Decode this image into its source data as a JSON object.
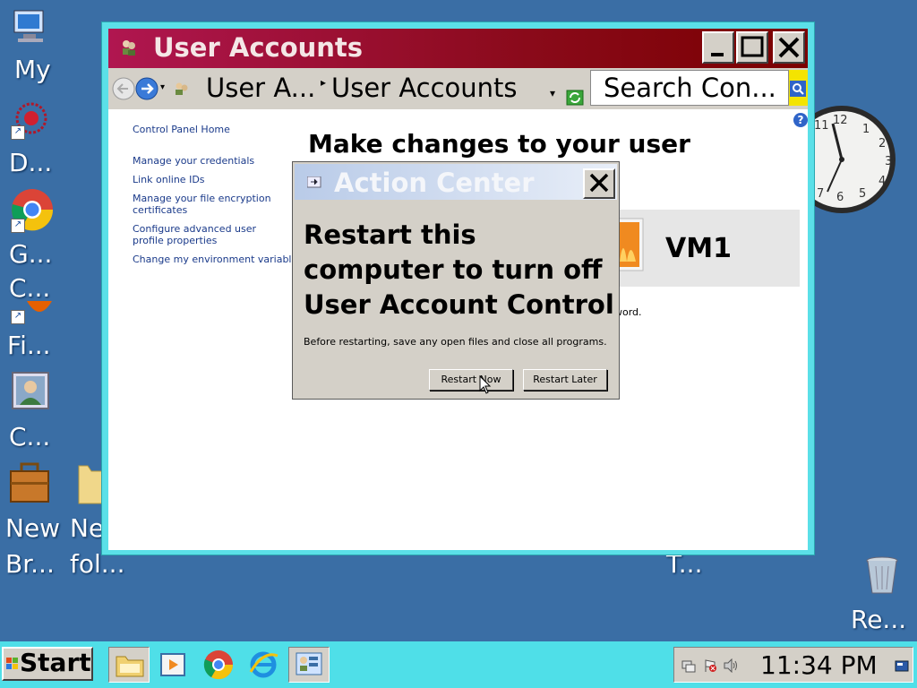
{
  "desktop": {
    "icons": [
      {
        "name": "my-computer",
        "label": "My"
      },
      {
        "name": "d-shortcut",
        "label": "D..."
      },
      {
        "name": "google-chrome",
        "label_line1": "G...",
        "label_line2": "C..."
      },
      {
        "name": "firefox",
        "label": "Fi..."
      },
      {
        "name": "c-shortcut",
        "label": "C..."
      },
      {
        "name": "new-briefcase",
        "label_line1": "New",
        "label_line2": "Br..."
      },
      {
        "name": "new-folder",
        "label_line1": "Ne",
        "label_line2": "fol..."
      },
      {
        "name": "recycle-bin",
        "label": "Re..."
      }
    ],
    "hidden_label_fragment": "T..."
  },
  "window": {
    "title": "User Accounts",
    "breadcrumb_1": "User A...",
    "breadcrumb_2": "User Accounts",
    "search_placeholder": "Search Con...",
    "sidebar": {
      "home": "Control Panel Home",
      "links": [
        "Manage your credentials",
        "Link online IDs",
        "Manage your file encryption certificates",
        "Configure advanced user profile properties",
        "Change my environment variables"
      ]
    },
    "heading": "Make changes to your user",
    "account_name": "VM1",
    "partial_text": "word."
  },
  "dialog": {
    "title": "Action Center",
    "message": "Restart this computer to turn off User Account Control",
    "subtext": "Before restarting, save any open files and close all programs.",
    "restart_now": "Restart Now",
    "restart_later": "Restart Later"
  },
  "taskbar": {
    "start_label": "Start",
    "time": "11:34 PM"
  },
  "colors": {
    "desktop": "#3a6ea5",
    "taskbar": "#4fdfe8",
    "titlebar_start": "#b01650",
    "titlebar_end": "#7a0000"
  }
}
